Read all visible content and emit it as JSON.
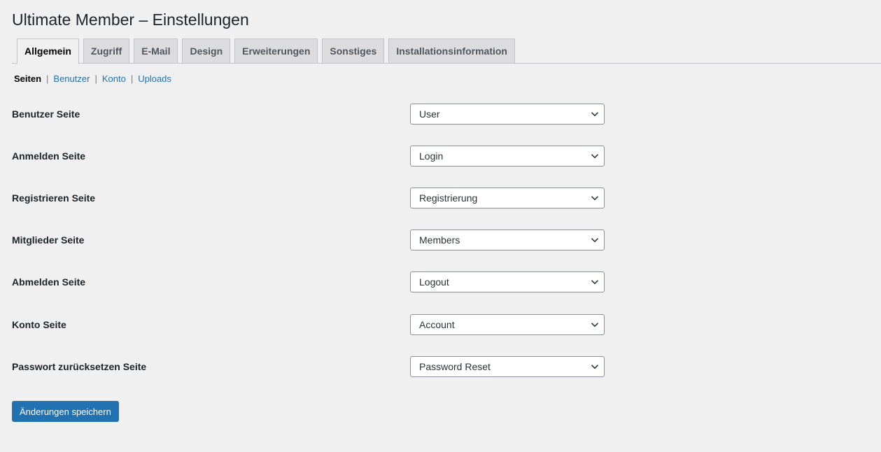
{
  "header": {
    "title": "Ultimate Member – Einstellungen"
  },
  "tabs": [
    {
      "label": "Allgemein",
      "active": true
    },
    {
      "label": "Zugriff",
      "active": false
    },
    {
      "label": "E-Mail",
      "active": false
    },
    {
      "label": "Design",
      "active": false
    },
    {
      "label": "Erweiterungen",
      "active": false
    },
    {
      "label": "Sonstiges",
      "active": false
    },
    {
      "label": "Installationsinformation",
      "active": false
    }
  ],
  "subnav": {
    "current": "Seiten",
    "links": [
      "Benutzer",
      "Konto",
      "Uploads"
    ],
    "separator": "|"
  },
  "settings": [
    {
      "label": "Benutzer Seite",
      "value": "User"
    },
    {
      "label": "Anmelden Seite",
      "value": "Login"
    },
    {
      "label": "Registrieren Seite",
      "value": "Registrierung"
    },
    {
      "label": "Mitglieder Seite",
      "value": "Members"
    },
    {
      "label": "Abmelden Seite",
      "value": "Logout"
    },
    {
      "label": "Konto Seite",
      "value": "Account"
    },
    {
      "label": "Passwort zurücksetzen Seite",
      "value": "Password Reset"
    }
  ],
  "actions": {
    "save_label": "Änderungen speichern"
  },
  "colors": {
    "background": "#f0f0f1",
    "accent": "#2271b1",
    "tab_inactive": "#dcdcde",
    "border": "#c3c4c7"
  },
  "icons": {
    "select_arrow": "chevron-down-icon"
  }
}
